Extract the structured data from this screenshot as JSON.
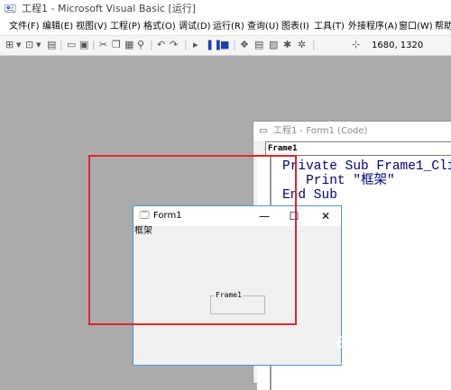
{
  "window": {
    "title": "工程1 - Microsoft Visual Basic [运行]",
    "icon": "vb-project-icon"
  },
  "menubar": {
    "items": [
      {
        "label": "文件(F)"
      },
      {
        "label": "编辑(E)"
      },
      {
        "label": "视图(V)"
      },
      {
        "label": "工程(P)"
      },
      {
        "label": "格式(O)"
      },
      {
        "label": "调试(D)"
      },
      {
        "label": "运行(R)"
      },
      {
        "label": "查询(U)"
      },
      {
        "label": "图表(I)"
      },
      {
        "label": "工具(T)"
      },
      {
        "label": "外接程序(A)"
      },
      {
        "label": "窗口(W)"
      },
      {
        "label": "帮助"
      }
    ]
  },
  "toolbar": {
    "coordinates": "1680, 1320"
  },
  "code_window": {
    "title": "工程1 - Form1 (Code)",
    "object_combo": "Frame1",
    "lines": [
      "Private Sub Frame1_Clic",
      "   Print \"框架\"",
      "End Sub"
    ]
  },
  "form_window": {
    "title": "Form1",
    "minimize_glyph": "—",
    "maximize_glyph": "☐",
    "close_glyph": "✕",
    "printed_text": "框架",
    "frame_caption": "Frame1"
  },
  "watermark": {
    "logo": "Bai❀经验",
    "url": "jingyan.baidu.com"
  },
  "colors": {
    "annotation": "#e0262a",
    "desktop": "#ababab",
    "code_keyword": "#000080",
    "form_border": "#4a90d9"
  }
}
